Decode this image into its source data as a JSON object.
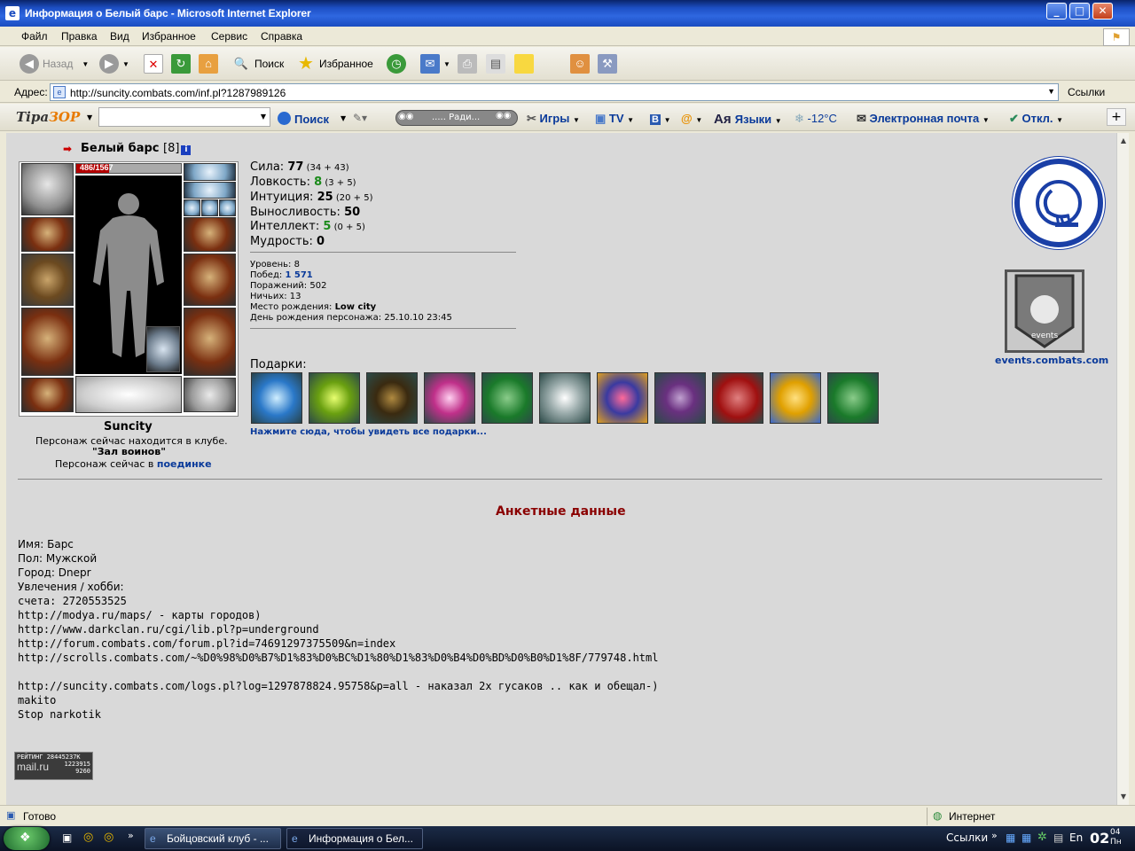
{
  "window": {
    "title": "Информация о Белый барс - Microsoft Internet Explorer"
  },
  "menu": [
    "Файл",
    "Правка",
    "Вид",
    "Избранное",
    "Сервис",
    "Справка"
  ],
  "toolbar": {
    "back": "Назад",
    "search": "Поиск",
    "favorites": "Избранное"
  },
  "address": {
    "label": "Адрес:",
    "url": "http://suncity.combats.com/inf.pl?1287989126",
    "links": "Ссылки"
  },
  "tirazor": {
    "logo_a": "Tipa",
    "logo_b": "ЗОР",
    "search": "Поиск",
    "radio": "..... Ради...",
    "games": "Игры",
    "tv": "TV",
    "languages": "Языки",
    "weather": "-12°C",
    "email": "Электронная почта",
    "off": "Откл."
  },
  "character": {
    "name": "Белый барс",
    "level_tag": "[8]",
    "hp": "486/1567",
    "hp_fraction": 0.31,
    "location": "Suncity",
    "club_line1": "Персонаж сейчас находится в клубе.",
    "club_name": "\"Зал воинов\"",
    "fight_prefix": "Персонаж сейчас в",
    "fight_link": "поединке"
  },
  "stats": [
    {
      "label": "Сила:",
      "value": "77",
      "extra": "(34 + 43)",
      "green": false
    },
    {
      "label": "Ловкость:",
      "value": "8",
      "extra": "(3 + 5)",
      "green": true
    },
    {
      "label": "Интуиция:",
      "value": "25",
      "extra": "(20 + 5)",
      "green": false
    },
    {
      "label": "Выносливость:",
      "value": "50",
      "extra": "",
      "green": false
    },
    {
      "label": "Интеллект:",
      "value": "5",
      "extra": "(0 + 5)",
      "green": true
    },
    {
      "label": "Мудрость:",
      "value": "0",
      "extra": "",
      "green": false
    }
  ],
  "info": {
    "level": "Уровень: 8",
    "wins_label": "Побед:",
    "wins": "1 571",
    "losses": "Поражений: 502",
    "draws": "Ничьих: 13",
    "birthplace_label": "Место рождения:",
    "birthplace": "Low city",
    "birthday": "День рождения персонажа: 25.10.10 23:45"
  },
  "gifts": {
    "label": "Подарки:",
    "link": "Нажмите сюда, чтобы увидеть все подарки..."
  },
  "events_link": "events.combats.com",
  "events_banner_text": "events",
  "anket_title": "Анкетные данные",
  "profile_lines": [
    "Имя: Барс",
    "Пол: Мужской",
    "Город: Dnepr",
    "Увлечения / хобби:",
    "счета: 2720553525",
    "http://modya.ru/maps/ - карты городов)",
    "http://www.darkclan.ru/cgi/lib.pl?p=underground",
    "http://forum.combats.com/forum.pl?id=74691297375509&n=index",
    "http://scrolls.combats.com/~%D0%98%D0%B7%D1%83%D0%BC%D1%80%D1%83%D0%B4%D0%BD%D0%B0%D1%8F/779748.html",
    "",
    "http://suncity.combats.com/logs.pl?log=1297878824.95758&p=all - наказал 2х гусаков .. как и обещал-)",
    "makito",
    "Stop narkotik"
  ],
  "mailru": {
    "line1": "РЕЙТИНГ 28445237К",
    "line2": "1223915",
    "line3": "9260",
    "logo": "mail.ru"
  },
  "status": {
    "left": "Готово",
    "right": "Интернет"
  },
  "taskbar": {
    "task1": "Бойцовский клуб - ...",
    "task2": "Информация о Бел...",
    "links": "Ссылки",
    "lang": "En",
    "time": "02",
    "time_min": "04",
    "day": "Пн"
  }
}
